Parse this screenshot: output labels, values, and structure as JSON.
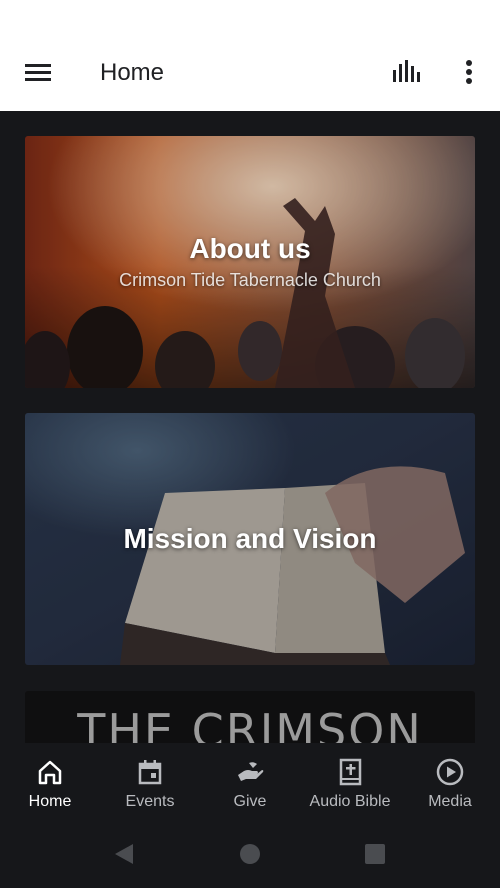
{
  "app_bar": {
    "title": "Home",
    "menu_icon": "hamburger-menu-icon",
    "audio_icon": "equalizer-icon",
    "more_icon": "more-vertical-icon"
  },
  "cards": [
    {
      "title": "About us",
      "subtitle": "Crimson Tide Tabernacle Church"
    },
    {
      "title": "Mission and Vision",
      "subtitle": ""
    },
    {
      "title": "THE CRIMSON",
      "subtitle": ""
    }
  ],
  "bottom_nav": {
    "items": [
      {
        "label": "Home",
        "icon": "home-icon",
        "active": true
      },
      {
        "label": "Events",
        "icon": "calendar-icon",
        "active": false
      },
      {
        "label": "Give",
        "icon": "give-hand-icon",
        "active": false
      },
      {
        "label": "Audio Bible",
        "icon": "bible-icon",
        "active": false
      },
      {
        "label": "Media",
        "icon": "play-circle-icon",
        "active": false
      }
    ]
  },
  "system_nav": [
    "back-icon",
    "home-circle-icon",
    "recents-icon"
  ],
  "colors": {
    "background": "#16171a",
    "appbar": "#ffffff",
    "nav_active": "#ffffff",
    "nav_inactive": "#b9bbbf"
  }
}
